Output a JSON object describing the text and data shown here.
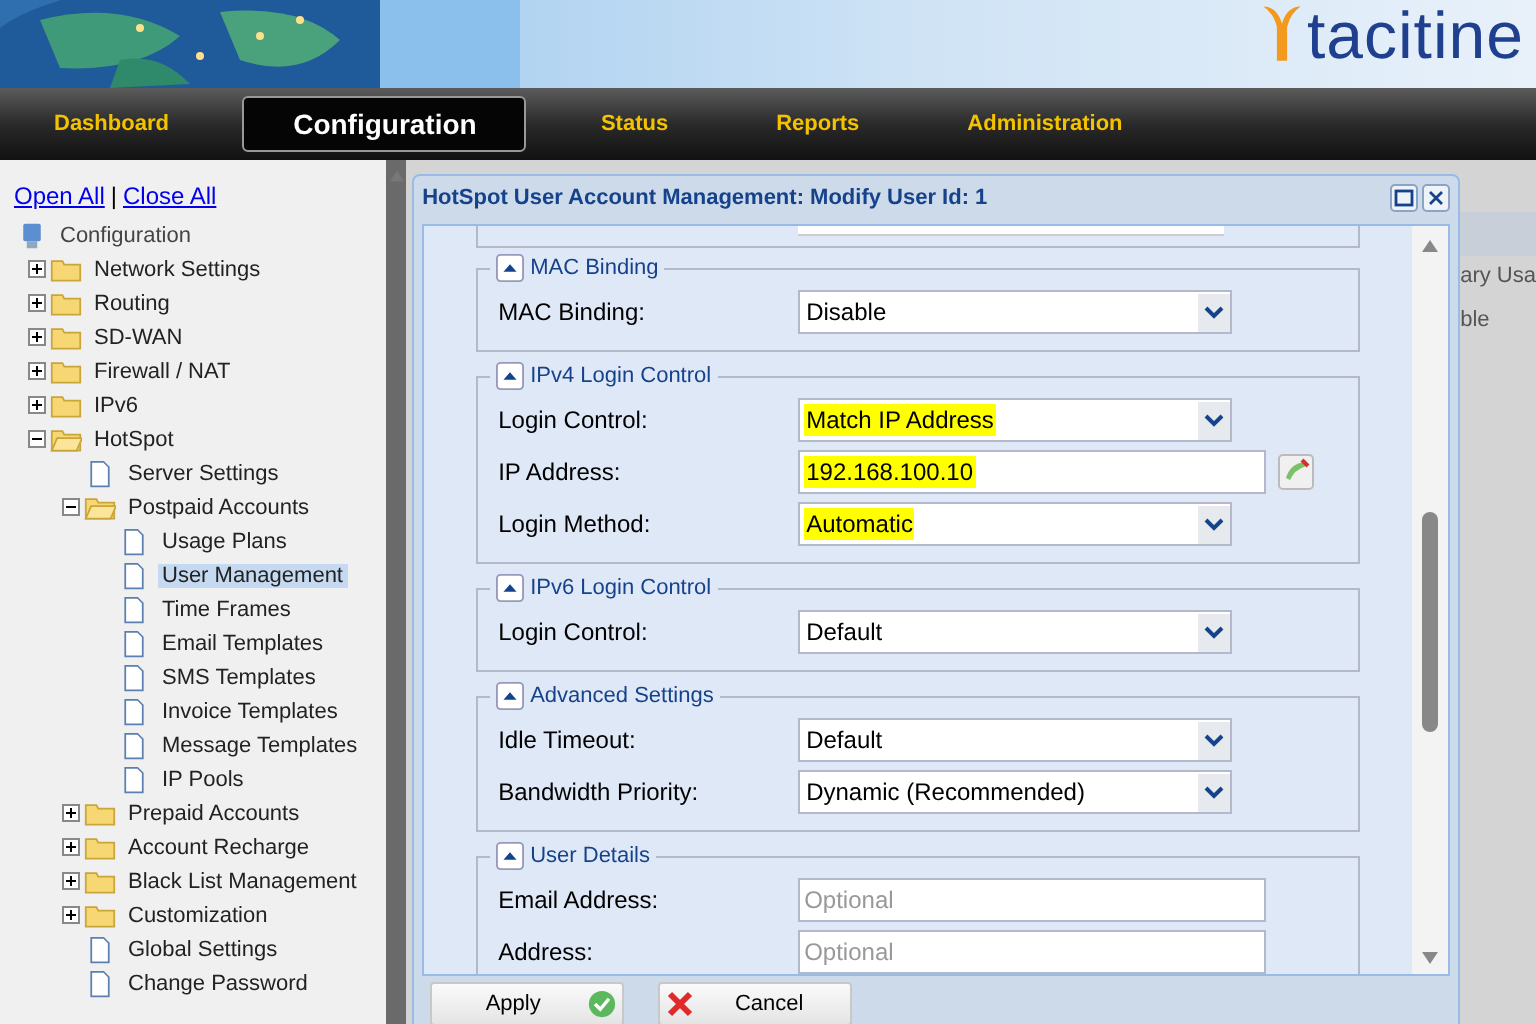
{
  "logo": {
    "text": "tacitine"
  },
  "nav": [
    {
      "label": "Dashboard",
      "selected": false
    },
    {
      "label": "Configuration",
      "selected": true
    },
    {
      "label": "Status",
      "selected": false
    },
    {
      "label": "Reports",
      "selected": false
    },
    {
      "label": "Administration",
      "selected": false
    }
  ],
  "sidebar": {
    "open_all": "Open All",
    "separator": "|",
    "close_all": "Close All",
    "tree": {
      "label": "Configuration",
      "children": [
        {
          "label": "Network Settings",
          "kind": "folder",
          "expanded": false,
          "selected": false
        },
        {
          "label": "Routing",
          "kind": "folder",
          "expanded": false,
          "selected": false
        },
        {
          "label": "SD-WAN",
          "kind": "folder",
          "expanded": false,
          "selected": false
        },
        {
          "label": "Firewall / NAT",
          "kind": "folder",
          "expanded": false,
          "selected": false
        },
        {
          "label": "IPv6",
          "kind": "folder",
          "expanded": false,
          "selected": false
        },
        {
          "label": "HotSpot",
          "kind": "folder",
          "expanded": true,
          "selected": false,
          "children": [
            {
              "label": "Server Settings",
              "kind": "page",
              "selected": false
            },
            {
              "label": "Postpaid Accounts",
              "kind": "folder",
              "expanded": true,
              "selected": false,
              "children": [
                {
                  "label": "Usage Plans",
                  "kind": "page",
                  "selected": false
                },
                {
                  "label": "User Management",
                  "kind": "page",
                  "selected": true
                },
                {
                  "label": "Time Frames",
                  "kind": "page",
                  "selected": false
                },
                {
                  "label": "Email Templates",
                  "kind": "page",
                  "selected": false
                },
                {
                  "label": "SMS Templates",
                  "kind": "page",
                  "selected": false
                },
                {
                  "label": "Invoice Templates",
                  "kind": "page",
                  "selected": false
                },
                {
                  "label": "Message Templates",
                  "kind": "page",
                  "selected": false
                },
                {
                  "label": "IP Pools",
                  "kind": "page",
                  "selected": false
                }
              ]
            },
            {
              "label": "Prepaid Accounts",
              "kind": "folder",
              "expanded": false,
              "selected": false
            },
            {
              "label": "Account Recharge",
              "kind": "folder",
              "expanded": false,
              "selected": false
            },
            {
              "label": "Black List Management",
              "kind": "folder",
              "expanded": false,
              "selected": false
            },
            {
              "label": "Customization",
              "kind": "folder",
              "expanded": false,
              "selected": false
            },
            {
              "label": "Global Settings",
              "kind": "page",
              "selected": false
            },
            {
              "label": "Change Password",
              "kind": "page",
              "selected": false
            }
          ]
        }
      ]
    }
  },
  "background_table": {
    "column_3": "ary Usa",
    "cell": "ble"
  },
  "dialog": {
    "title": "HotSpot User Account Management: Modify User Id: 1",
    "sections": [
      {
        "legend": "MAC Binding",
        "fields": [
          {
            "label": "MAC Binding:",
            "kind": "select",
            "value": "Disable",
            "highlighted": false
          }
        ]
      },
      {
        "legend": "IPv4 Login Control",
        "fields": [
          {
            "label": "Login Control:",
            "kind": "select",
            "value": "Match IP Address",
            "highlighted": true
          },
          {
            "label": "IP Address:",
            "kind": "text",
            "value": "192.168.100.10",
            "highlighted": true
          },
          {
            "label": "Login Method:",
            "kind": "select",
            "value": "Automatic",
            "highlighted": true
          }
        ]
      },
      {
        "legend": "IPv6 Login Control",
        "fields": [
          {
            "label": "Login Control:",
            "kind": "select",
            "value": "Default",
            "highlighted": false
          }
        ]
      },
      {
        "legend": "Advanced Settings",
        "fields": [
          {
            "label": "Idle Timeout:",
            "kind": "select",
            "value": "Default",
            "highlighted": false
          },
          {
            "label": "Bandwidth Priority:",
            "kind": "select",
            "value": "Dynamic (Recommended)",
            "highlighted": false
          }
        ]
      },
      {
        "legend": "User Details",
        "fields": [
          {
            "label": "Email Address:",
            "kind": "text",
            "placeholder": "Optional",
            "highlighted": false
          },
          {
            "label": "Address:",
            "kind": "text",
            "placeholder": "Optional",
            "highlighted": false
          }
        ]
      }
    ],
    "buttons": [
      {
        "label": "Apply",
        "kind": "apply"
      },
      {
        "label": "Cancel",
        "kind": "cancel"
      }
    ]
  }
}
